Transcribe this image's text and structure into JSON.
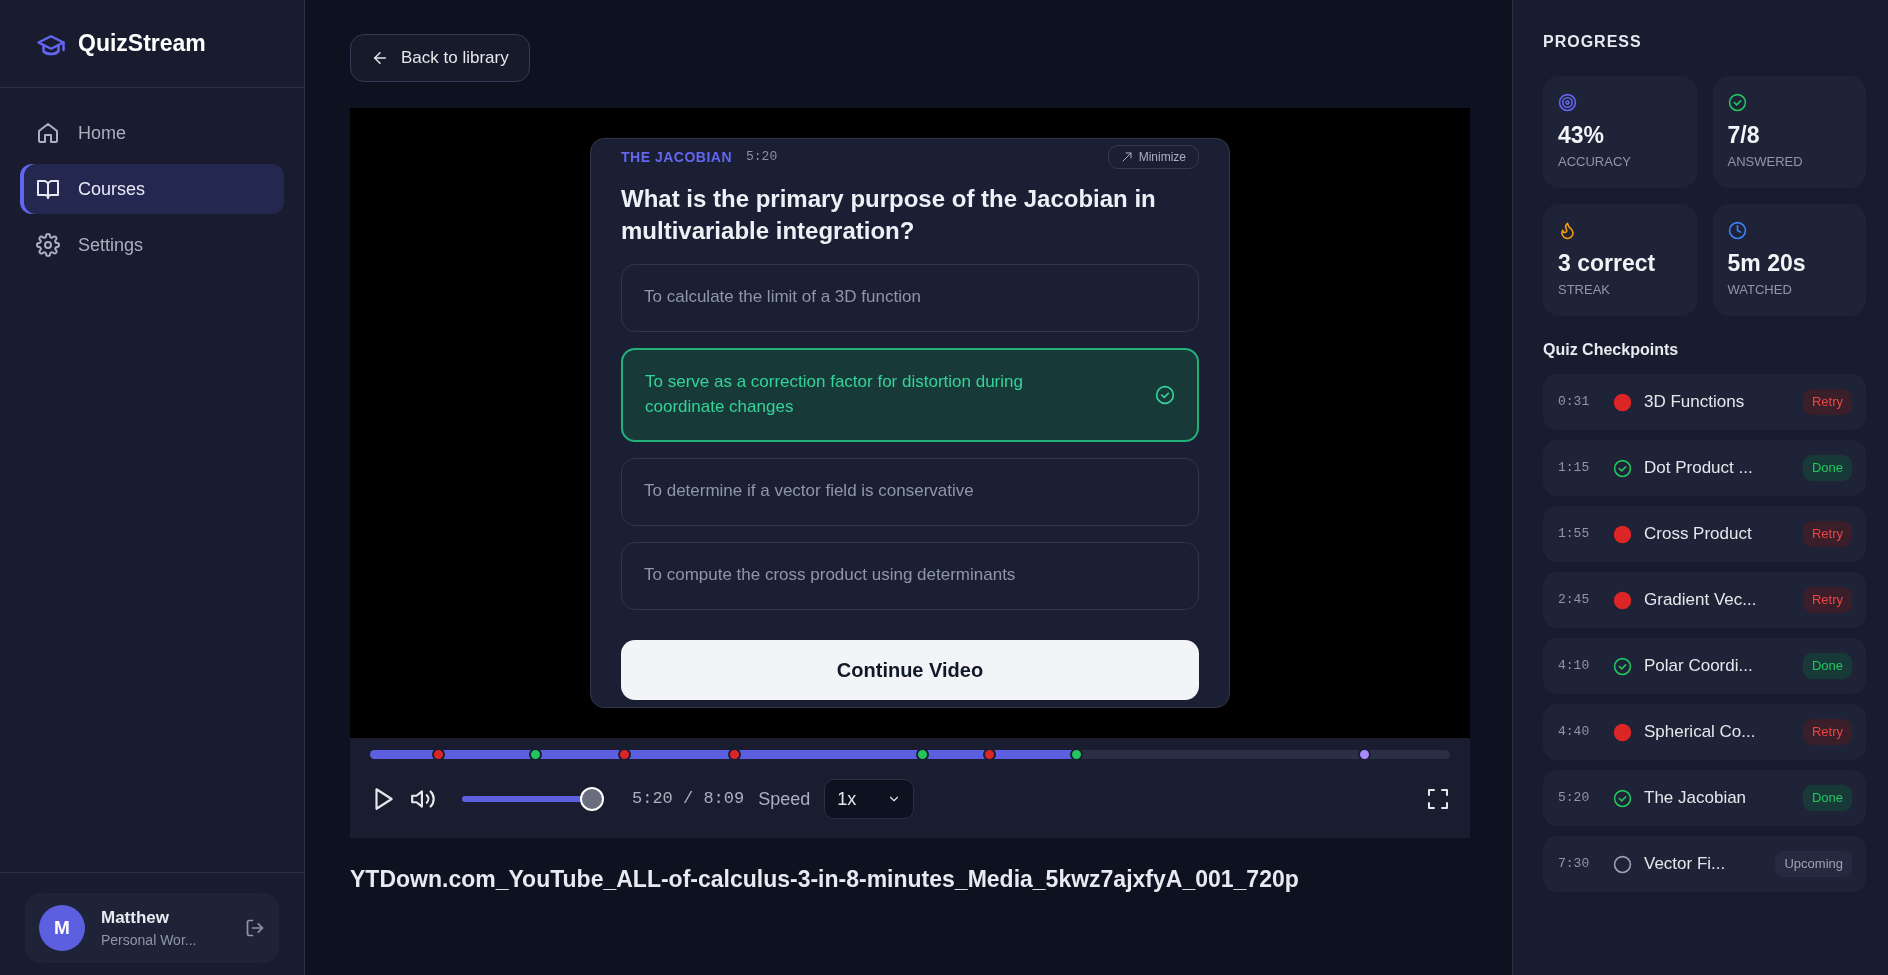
{
  "sidebar": {
    "brand": "QuizStream",
    "items": [
      {
        "label": "Home",
        "kind": "home",
        "selected": false
      },
      {
        "label": "Courses",
        "kind": "courses",
        "selected": true
      },
      {
        "label": "Settings",
        "kind": "settings",
        "selected": false
      }
    ],
    "user": {
      "initial": "M",
      "name": "Matthew",
      "workspace": "Personal Wor..."
    }
  },
  "back_button": "Back to library",
  "quiz": {
    "topic": "THE JACOBIAN",
    "time": "5:20",
    "minimize": "Minimize",
    "question": "What is the primary purpose of the Jacobian in multivariable integration?",
    "options": [
      {
        "text": "To calculate the limit of a 3D function",
        "selected": false
      },
      {
        "text": "To serve as a correction factor for distortion during coordinate changes",
        "selected": true
      },
      {
        "text": "To determine if a vector field is conservative",
        "selected": false
      },
      {
        "text": "To compute the cross product using determinants",
        "selected": false
      }
    ],
    "continue": "Continue Video"
  },
  "player": {
    "progress": {
      "level": 0.654
    },
    "markers": [
      {
        "level": 0.063,
        "color": "#dc2626"
      },
      {
        "level": 0.153,
        "color": "#22c55e"
      },
      {
        "level": 0.235,
        "color": "#dc2626"
      },
      {
        "level": 0.337,
        "color": "#dc2626"
      },
      {
        "level": 0.511,
        "color": "#22c55e"
      },
      {
        "level": 0.573,
        "color": "#dc2626"
      },
      {
        "level": 0.654,
        "color": "#22c55e"
      },
      {
        "level": 0.92,
        "color": "#a78bfa"
      }
    ],
    "volume": {
      "level": 1.0
    },
    "time": "5:20 / 8:09",
    "speed_label": "Speed",
    "speed": "1x"
  },
  "video_title": "YTDown.com_YouTube_ALL-of-calculus-3-in-8-minutes_Media_5kwz7ajxfyA_001_720p",
  "progress": {
    "heading": "PROGRESS",
    "stats": [
      {
        "kind": "accuracy",
        "value": "43%",
        "label": "ACCURACY"
      },
      {
        "kind": "answered",
        "value": "7/8",
        "label": "ANSWERED"
      },
      {
        "kind": "streak",
        "value": "3 correct",
        "label": "STREAK"
      },
      {
        "kind": "watched",
        "value": "5m 20s",
        "label": "WATCHED"
      }
    ]
  },
  "checkpoints": {
    "heading": "Quiz Checkpoints",
    "items": [
      {
        "time": "0:31",
        "title": "3D Functions",
        "kind": "retry",
        "badge": "Retry"
      },
      {
        "time": "1:15",
        "title": "Dot Product ...",
        "kind": "done",
        "badge": "Done"
      },
      {
        "time": "1:55",
        "title": "Cross Product",
        "kind": "retry",
        "badge": "Retry"
      },
      {
        "time": "2:45",
        "title": "Gradient Vec...",
        "kind": "retry",
        "badge": "Retry"
      },
      {
        "time": "4:10",
        "title": "Polar Coordi...",
        "kind": "done",
        "badge": "Done"
      },
      {
        "time": "4:40",
        "title": "Spherical Co...",
        "kind": "retry",
        "badge": "Retry"
      },
      {
        "time": "5:20",
        "title": "The Jacobian",
        "kind": "done",
        "badge": "Done"
      },
      {
        "time": "7:30",
        "title": "Vector Fi...",
        "kind": "upcoming",
        "badge": "Upcoming"
      }
    ]
  }
}
